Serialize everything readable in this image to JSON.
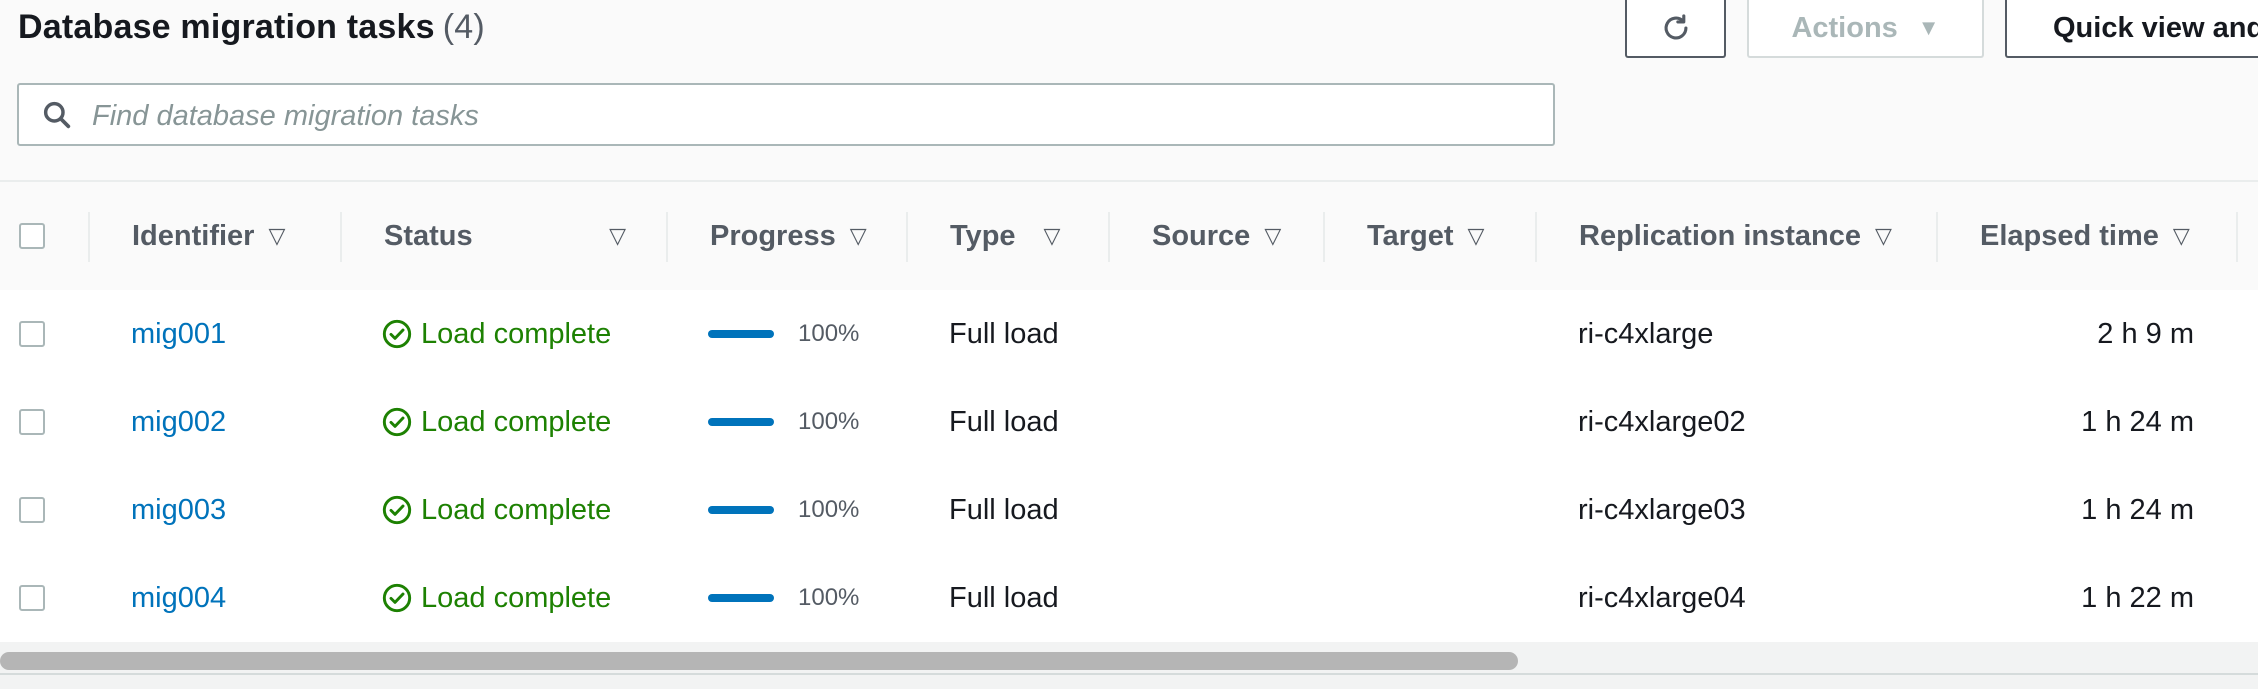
{
  "header": {
    "title": "Database migration tasks",
    "count": "(4)",
    "actions_label": "Actions",
    "quick_view_label": "Quick view and"
  },
  "icons": {
    "refresh": "refresh-icon",
    "actions_caret": "caret-down-icon",
    "search": "search-icon",
    "sort": "sort-triangle-icon",
    "status_ok": "check-circle-icon"
  },
  "search": {
    "placeholder": "Find database migration tasks"
  },
  "table": {
    "columns": [
      "Identifier",
      "Status",
      "Progress",
      "Type",
      "Source",
      "Target",
      "Replication instance",
      "Elapsed time"
    ],
    "rows": [
      {
        "identifier": "mig001",
        "status": "Load complete",
        "progress": 1.0,
        "progress_label": "100%",
        "type": "Full load",
        "source": "",
        "target": "",
        "replication_instance": "ri-c4xlarge",
        "elapsed": "2 h 9 m"
      },
      {
        "identifier": "mig002",
        "status": "Load complete",
        "progress": 1.0,
        "progress_label": "100%",
        "type": "Full load",
        "source": "",
        "target": "",
        "replication_instance": "ri-c4xlarge02",
        "elapsed": "1 h 24 m"
      },
      {
        "identifier": "mig003",
        "status": "Load complete",
        "progress": 1.0,
        "progress_label": "100%",
        "type": "Full load",
        "source": "",
        "target": "",
        "replication_instance": "ri-c4xlarge03",
        "elapsed": "1 h 24 m"
      },
      {
        "identifier": "mig004",
        "status": "Load complete",
        "progress": 1.0,
        "progress_label": "100%",
        "type": "Full load",
        "source": "",
        "target": "",
        "replication_instance": "ri-c4xlarge04",
        "elapsed": "1 h 22 m"
      }
    ]
  },
  "colors": {
    "link": "#0073bb",
    "success": "#1d8102",
    "progress_bar": "#0073bb",
    "border": "#545b64",
    "muted": "#aab7b8"
  }
}
